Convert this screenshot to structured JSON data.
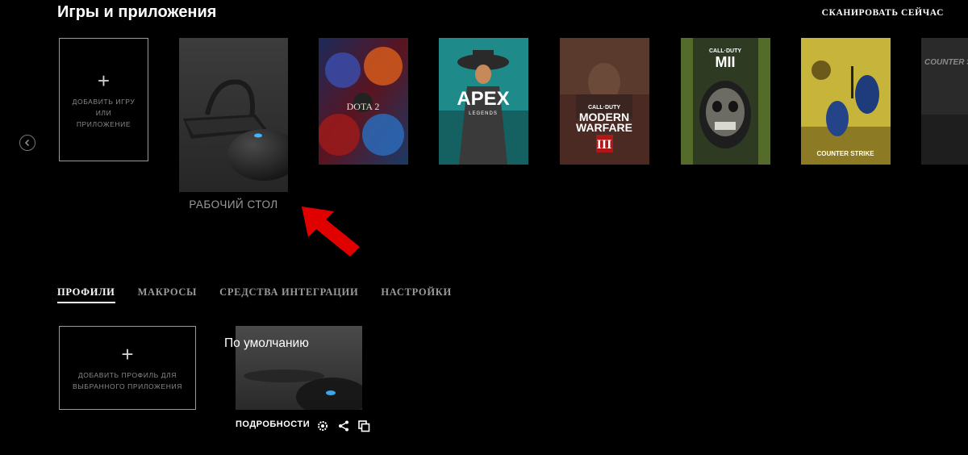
{
  "header": {
    "title": "Игры и приложения",
    "scan_label": "СКАНИРОВАТЬ СЕЙЧАС"
  },
  "carousel": {
    "prev_icon": "chevron-left-icon",
    "next_icon": "chevron-right-icon",
    "add_game_label": "ДОБАВИТЬ ИГРУ\nИЛИ\nПРИЛОЖЕНИЕ",
    "desktop_label": "РАБОЧИЙ СТОЛ",
    "games": [
      {
        "id": "dota",
        "logo_text": "DOTA 2"
      },
      {
        "id": "apex",
        "logo_text": "APEX",
        "sub_text": "LEGENDS"
      },
      {
        "id": "mw3",
        "top_text": "CALL·DUTY",
        "logo_text": "MODERN",
        "logo_text2": "WARFARE",
        "badge": "III"
      },
      {
        "id": "mw2",
        "top_text": "CALL·DUTY",
        "badge": "MII"
      },
      {
        "id": "cs",
        "logo_text": "COUNTER STRIKE"
      },
      {
        "id": "cs2",
        "logo_text": "COUNTER STRI"
      }
    ]
  },
  "annotation": {
    "arrow_color": "#e00000"
  },
  "tabs": [
    {
      "label": "ПРОФИЛИ",
      "active": true
    },
    {
      "label": "МАКРОСЫ",
      "active": false
    },
    {
      "label": "СРЕДСТВА ИНТЕГРАЦИИ",
      "active": false
    },
    {
      "label": "НАСТРОЙКИ",
      "active": false
    }
  ],
  "profiles": {
    "add_profile_label": "ДОБАВИТЬ ПРОФИЛЬ ДЛЯ\nВЫБРАННОГО ПРИЛОЖЕНИЯ",
    "default_profile_name": "По умолчанию",
    "details_label": "ПОДРОБНОСТИ",
    "action_icons": [
      "settings-icon",
      "share-icon",
      "copy-icon"
    ]
  },
  "colors": {
    "background": "#000000",
    "text_dim": "#9a9a9a",
    "accent_blue": "#3fb6ff"
  }
}
